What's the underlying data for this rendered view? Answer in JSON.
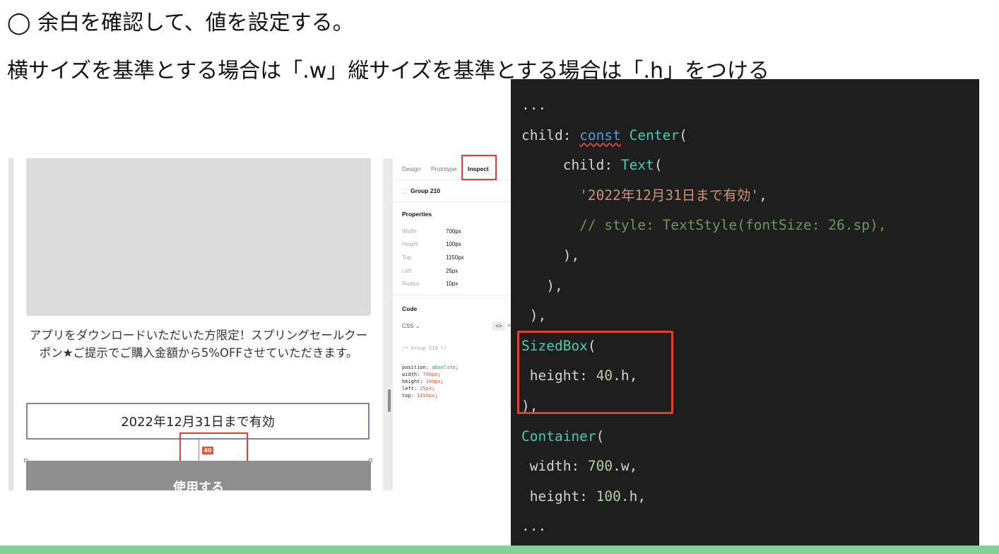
{
  "instructions": {
    "line1": "◯ 余白を確認して、値を設定する。",
    "line2": "横サイズを基準とする場合は「.w」縦サイズを基準とする場合は「.h」をつける"
  },
  "preview": {
    "description": "アプリをダウンロードいただいた方限定！スプリングセールクーポン★ご提示でご購入金額から5%OFFさせていただきます。",
    "date_text": "2022年12月31日まで有効",
    "spacing_badge": "40",
    "button_label": "使用する"
  },
  "inspector": {
    "tabs": [
      "Design",
      "Prototype",
      "Inspect"
    ],
    "active_tab": "Inspect",
    "layer_icon": "group-frame-icon",
    "layer_name": "Group 210",
    "properties_title": "Properties",
    "properties": [
      {
        "label": "Width",
        "value": "700px"
      },
      {
        "label": "Height",
        "value": "100px"
      },
      {
        "label": "Top",
        "value": "1150px"
      },
      {
        "label": "Left",
        "value": "25px"
      },
      {
        "label": "Radius",
        "value": "10px"
      }
    ],
    "code_title": "Code",
    "code_format": "CSS ⌄",
    "code_toggle": "<>",
    "code_toggle_extra": "≡",
    "code_comment": "/* Group 210 */",
    "css_lines": [
      {
        "prop": "position: ",
        "value": "absolute",
        "end": ";"
      },
      {
        "prop": "width: ",
        "value": "700px",
        "end": ";"
      },
      {
        "prop": "height: ",
        "value": "100px",
        "end": ";"
      },
      {
        "prop": "left: ",
        "value": "25px",
        "end": ";"
      },
      {
        "prop": "top: ",
        "value": "1150px",
        "end": ";"
      }
    ]
  },
  "editor": {
    "lines": [
      [
        {
          "t": "...",
          "c": ""
        }
      ],
      [
        {
          "t": "child: ",
          "c": ""
        },
        {
          "t": "const",
          "c": "kw"
        },
        {
          "t": " ",
          "c": ""
        },
        {
          "t": "Center",
          "c": "cls"
        },
        {
          "t": "(",
          "c": ""
        }
      ],
      [
        {
          "t": "     child: ",
          "c": ""
        },
        {
          "t": "Text",
          "c": "cls"
        },
        {
          "t": "(",
          "c": ""
        }
      ],
      [
        {
          "t": "       ",
          "c": ""
        },
        {
          "t": "'2022年12月31日まで有効'",
          "c": "str"
        },
        {
          "t": ",",
          "c": ""
        }
      ],
      [
        {
          "t": "       ",
          "c": ""
        },
        {
          "t": "// style: TextStyle(fontSize: 26.sp),",
          "c": "cmt"
        }
      ],
      [
        {
          "t": "     ),",
          "c": ""
        }
      ],
      [
        {
          "t": "   ),",
          "c": ""
        }
      ],
      [
        {
          "t": " ),",
          "c": ""
        }
      ],
      [
        {
          "t": "SizedBox",
          "c": "cls"
        },
        {
          "t": "(",
          "c": ""
        }
      ],
      [
        {
          "t": " height: ",
          "c": ""
        },
        {
          "t": "40",
          "c": "num"
        },
        {
          "t": ".h,",
          "c": ""
        }
      ],
      [
        {
          "t": "),",
          "c": ""
        }
      ],
      [
        {
          "t": "Container",
          "c": "cls"
        },
        {
          "t": "(",
          "c": ""
        }
      ],
      [
        {
          "t": " width: ",
          "c": ""
        },
        {
          "t": "700",
          "c": "num"
        },
        {
          "t": ".w,",
          "c": ""
        }
      ],
      [
        {
          "t": " height: ",
          "c": ""
        },
        {
          "t": "100",
          "c": "num"
        },
        {
          "t": ".h,",
          "c": ""
        }
      ],
      [
        {
          "t": "...",
          "c": ""
        }
      ]
    ]
  },
  "colors": {
    "highlight": "#e0412f",
    "editor_bg": "#1e1e1e",
    "footer_bar": "#86cf95"
  }
}
